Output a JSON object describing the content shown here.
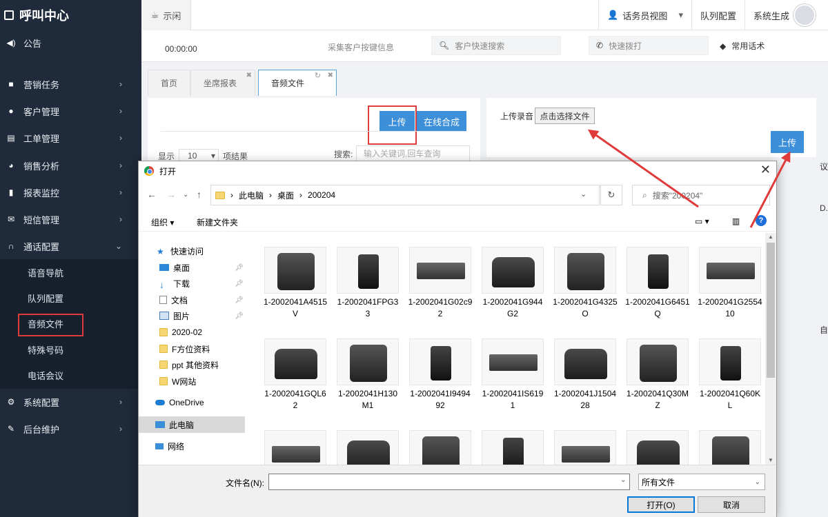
{
  "sidebar": {
    "title": "呼叫中心",
    "items": [
      {
        "label": "公告",
        "icon": "speaker-icon"
      },
      {
        "label": "营销任务",
        "icon": "briefcase-icon"
      },
      {
        "label": "客户管理",
        "icon": "user-icon"
      },
      {
        "label": "工单管理",
        "icon": "document-icon"
      },
      {
        "label": "销售分析",
        "icon": "pie-icon"
      },
      {
        "label": "报表监控",
        "icon": "bar-chart-icon"
      },
      {
        "label": "短信管理",
        "icon": "envelope-icon"
      },
      {
        "label": "通话配置",
        "icon": "headset-icon"
      },
      {
        "label": "系统配置",
        "icon": "gear-icon"
      },
      {
        "label": "后台维护",
        "icon": "wrench-icon"
      }
    ],
    "subitems": [
      "语音导航",
      "队列配置",
      "音频文件",
      "特殊号码",
      "电话会议"
    ]
  },
  "topbar": {
    "status": "示闲",
    "agent_view": "话务员视图",
    "queue_config": "队列配置",
    "system_generated": "系统生成"
  },
  "infobar": {
    "timer": "00:00:00",
    "collect": "采集客户按键信息",
    "quick_search": "客户快速搜索",
    "quick_dial": "快速拨打",
    "phrases": "常用话术"
  },
  "tabs": [
    "首页",
    "坐席报表",
    "音频文件"
  ],
  "left_panel": {
    "upload": "上传",
    "synth": "在线合成",
    "show": "显示",
    "page_size": "10",
    "results": "项结果",
    "search_label": "搜索:",
    "search_placeholder": "输入关键词,回车查询"
  },
  "right_panel": {
    "label": "上传录音",
    "choose": "点击选择文件",
    "upload": "上传"
  },
  "edge_fragments": [
    "议",
    "D.v",
    "自"
  ],
  "dialog": {
    "title": "打开",
    "path": [
      "此电脑",
      "桌面",
      "200204"
    ],
    "search_placeholder": "搜索\"200204\"",
    "organize": "组织",
    "new_folder": "新建文件夹",
    "nav": [
      {
        "label": "快速访问",
        "icon": "star-icon"
      },
      {
        "label": "桌面",
        "icon": "desktop-icon",
        "pinned": true
      },
      {
        "label": "下载",
        "icon": "download-icon",
        "pinned": true
      },
      {
        "label": "文档",
        "icon": "document-icon",
        "pinned": true
      },
      {
        "label": "图片",
        "icon": "picture-icon",
        "pinned": true
      },
      {
        "label": "2020-02",
        "icon": "folder-icon"
      },
      {
        "label": "F方位资料",
        "icon": "folder-icon"
      },
      {
        "label": "ppt 其他资料",
        "icon": "folder-icon"
      },
      {
        "label": "W网站",
        "icon": "folder-icon"
      },
      {
        "label": "OneDrive",
        "icon": "cloud-icon"
      },
      {
        "label": "此电脑",
        "icon": "computer-icon"
      },
      {
        "label": "网络",
        "icon": "network-icon"
      }
    ],
    "files": [
      "1-2002041A4515V",
      "1-2002041FPG33",
      "1-2002041G02c92",
      "1-2002041G944G2",
      "1-2002041G4325O",
      "1-2002041G6451Q",
      "1-2002041G255410",
      "1-2002041GQL62",
      "1-2002041H130M1",
      "1-2002041I949492",
      "1-2002041IS6191",
      "1-2002041J150428",
      "1-2002041Q30MZ",
      "1-2002041Q60KL",
      "",
      "",
      "",
      "",
      "",
      "",
      ""
    ],
    "filename_label": "文件名(N):",
    "filetype": "所有文件",
    "open": "打开(O)",
    "cancel": "取消"
  },
  "colors": {
    "sidebar": "#1f2a3a",
    "accent": "#3d8fd9",
    "highlight": "#e03b3b"
  }
}
